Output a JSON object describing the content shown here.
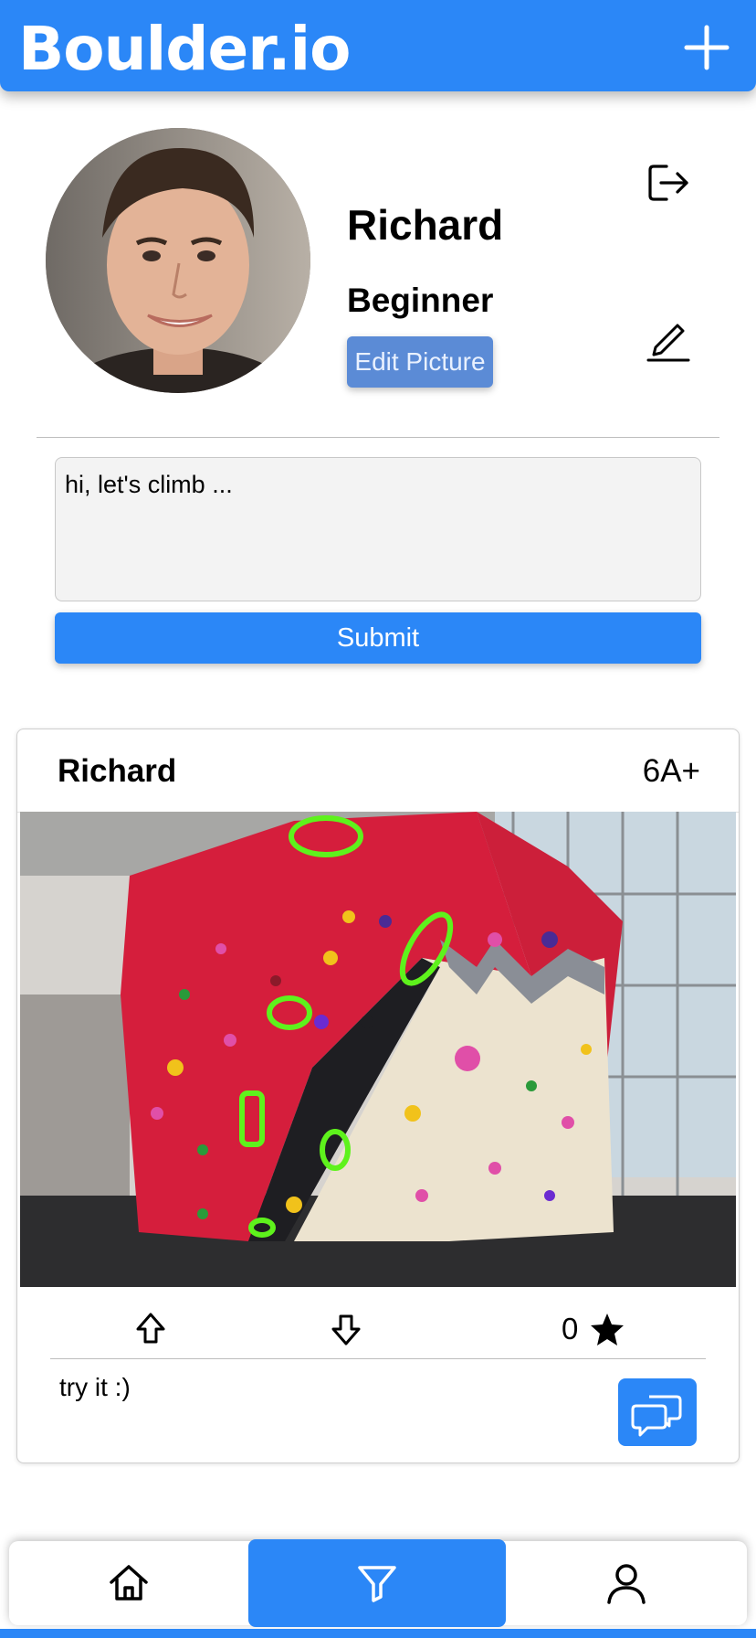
{
  "header": {
    "brand": "Boulder.io",
    "add_icon": "plus-icon",
    "color": "#2b87f7"
  },
  "profile": {
    "name": "Richard",
    "level": "Beginner",
    "edit_picture_label": "Edit Picture",
    "logout_icon": "logout-icon",
    "edit_icon": "pencil-icon",
    "bio_value": "hi, let's climb ...",
    "submit_label": "Submit"
  },
  "post": {
    "author": "Richard",
    "grade": "6A+",
    "upvote_icon": "arrow-up-icon",
    "downvote_icon": "arrow-down-icon",
    "rating": "0",
    "star_icon": "star-icon",
    "comment": "try it :)",
    "chat_icon": "chat-icon"
  },
  "bottom_nav": {
    "items": [
      {
        "name": "home",
        "icon": "home-icon"
      },
      {
        "name": "filter",
        "icon": "filter-icon",
        "active": true
      },
      {
        "name": "profile",
        "icon": "user-icon"
      }
    ]
  }
}
